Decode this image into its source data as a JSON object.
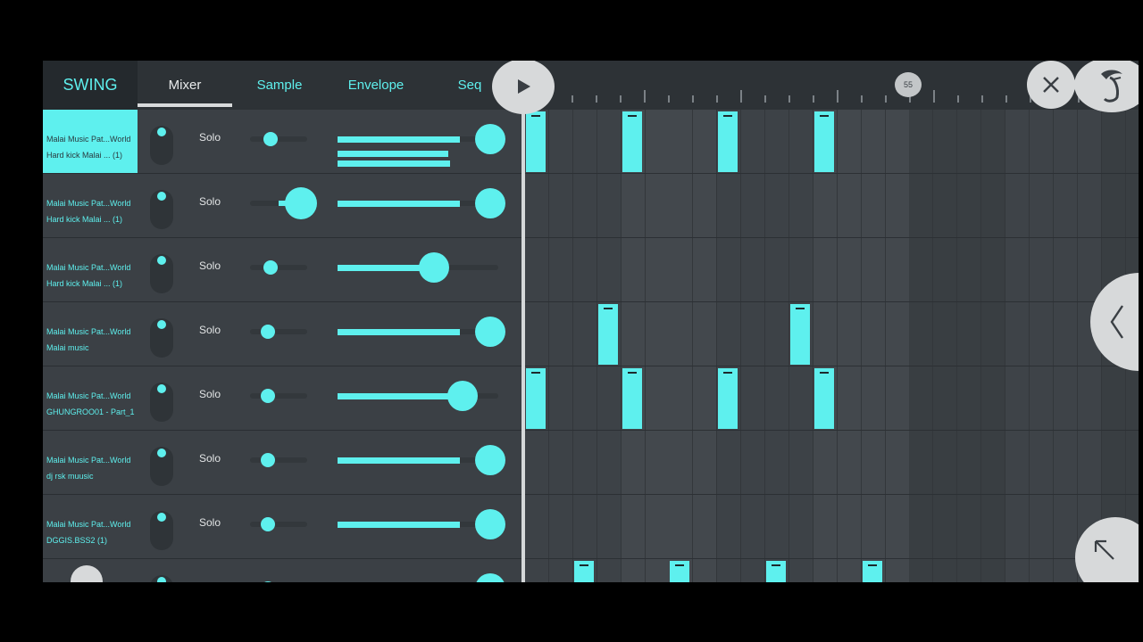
{
  "topbar": {
    "swing_label": "SWING",
    "tabs": [
      {
        "label": "Mixer",
        "active": true
      },
      {
        "label": "Sample",
        "active": false
      },
      {
        "label": "Envelope",
        "active": false
      },
      {
        "label": "Seq",
        "active": false
      }
    ],
    "position_badge": "55"
  },
  "icons": {
    "play": "play-icon",
    "close": "close-icon",
    "logo": "fruit-logo-icon",
    "prev": "chevron-left-icon",
    "expand": "arrow-up-left-icon"
  },
  "colors": {
    "accent": "#5ef0ee",
    "background": "#3a3f44",
    "panel_dark": "#24292d"
  },
  "channels": [
    {
      "line1": "Malai Music Pat...World",
      "line2": "Hard kick Malai ...  (1)",
      "solo": "Solo",
      "selected": true,
      "pan": 0.55,
      "volume": 0.84,
      "steps": [
        0,
        4,
        8,
        12
      ]
    },
    {
      "line1": "Malai Music Pat...World",
      "line2": "Hard kick Malai ...  (1)",
      "solo": "Solo",
      "selected": false,
      "pan": 0.95,
      "volume": 0.84,
      "steps": []
    },
    {
      "line1": "Malai Music Pat...World",
      "line2": "Hard kick Malai ...  (1)",
      "solo": "Solo",
      "selected": false,
      "pan": 0.55,
      "volume": 0.6,
      "steps": []
    },
    {
      "line1": "Malai Music Pat...World",
      "line2": "Malai music",
      "solo": "Solo",
      "selected": false,
      "pan": 0.5,
      "volume": 0.84,
      "steps": [
        3,
        11
      ]
    },
    {
      "line1": "Malai Music Pat...World",
      "line2": "GHUNGROO01 - Part_1",
      "solo": "Solo",
      "selected": false,
      "pan": 0.5,
      "volume": 0.78,
      "steps": [
        0,
        4,
        8,
        12
      ]
    },
    {
      "line1": "Malai Music Pat...World",
      "line2": "dj rsk muusic",
      "solo": "Solo",
      "selected": false,
      "pan": 0.5,
      "volume": 0.84,
      "steps": []
    },
    {
      "line1": "Malai Music Pat...World",
      "line2": "DGGIS.BSS2 (1)",
      "solo": "Solo",
      "selected": false,
      "pan": 0.5,
      "volume": 0.84,
      "steps": []
    },
    {
      "line1": "",
      "line2": "",
      "solo": "",
      "selected": false,
      "pan": 0.5,
      "volume": 0.84,
      "steps": [
        2,
        6,
        10,
        14
      ]
    }
  ]
}
